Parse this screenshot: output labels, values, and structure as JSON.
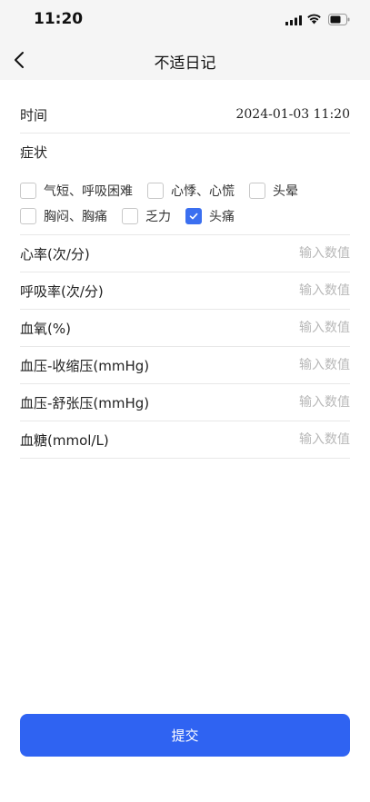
{
  "status_bar": {
    "time": "11:20"
  },
  "nav": {
    "title": "不适日记"
  },
  "form": {
    "time_label": "时间",
    "time_value": "2024-01-03 11:20",
    "symptom_label": "症状",
    "symptoms": [
      {
        "label": "气短、呼吸困难",
        "checked": false
      },
      {
        "label": "心悸、心慌",
        "checked": false
      },
      {
        "label": "头晕",
        "checked": false
      },
      {
        "label": "胸闷、胸痛",
        "checked": false
      },
      {
        "label": "乏力",
        "checked": false
      },
      {
        "label": "头痛",
        "checked": true
      }
    ],
    "fields": [
      {
        "label": "心率(次/分)",
        "placeholder": "输入数值",
        "value": ""
      },
      {
        "label": "呼吸率(次/分)",
        "placeholder": "输入数值",
        "value": ""
      },
      {
        "label": "血氧(%)",
        "placeholder": "输入数值",
        "value": ""
      },
      {
        "label": "血压-收缩压(mmHg)",
        "placeholder": "输入数值",
        "value": ""
      },
      {
        "label": "血压-舒张压(mmHg)",
        "placeholder": "输入数值",
        "value": ""
      },
      {
        "label": "血糖(mmol/L)",
        "placeholder": "输入数值",
        "value": ""
      }
    ]
  },
  "submit": {
    "label": "提交"
  },
  "icons": {
    "back": "back-arrow-icon",
    "signal": "cellular-signal-icon",
    "wifi": "wifi-icon",
    "battery": "battery-icon",
    "check": "checkmark-icon"
  },
  "colors": {
    "accent": "#2f63f2",
    "checkbox_checked": "#3b6ff0"
  }
}
